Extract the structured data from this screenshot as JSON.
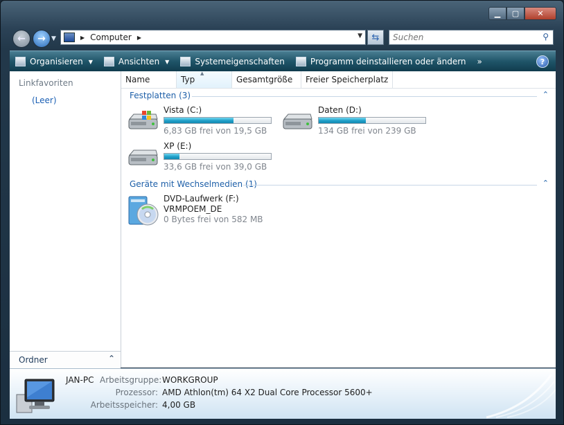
{
  "window": {
    "buttons": {
      "minimize": "▁",
      "maximize": "▢",
      "close": "✕"
    }
  },
  "address": {
    "location": "Computer",
    "separator_icon": "chevron-right"
  },
  "search": {
    "placeholder": "Suchen"
  },
  "toolbar": {
    "items": [
      {
        "label": "Organisieren",
        "icon": "organize-icon",
        "has_dropdown": true
      },
      {
        "label": "Ansichten",
        "icon": "views-icon",
        "has_dropdown": true
      },
      {
        "label": "Systemeigenschaften",
        "icon": "system-properties-icon",
        "has_dropdown": false
      },
      {
        "label": "Programm deinstallieren oder ändern",
        "icon": "uninstall-icon",
        "has_dropdown": false
      }
    ],
    "overflow": "»"
  },
  "left_pane": {
    "title": "Linkfavoriten",
    "items": [
      "(Leer)"
    ],
    "folders_label": "Ordner"
  },
  "columns": [
    "Name",
    "Typ",
    "Gesamtgröße",
    "Freier Speicherplatz"
  ],
  "groups": {
    "hard_disks": {
      "title": "Festplatten (3)",
      "drives": [
        {
          "name": "Vista (C:)",
          "free_text": "6,83 GB frei von 19,5 GB",
          "used_fraction": 0.65,
          "os_logo": true
        },
        {
          "name": "Daten (D:)",
          "free_text": "134 GB frei von 239 GB",
          "used_fraction": 0.44,
          "os_logo": false
        },
        {
          "name": "XP (E:)",
          "free_text": "33,6 GB frei von 39,0 GB",
          "used_fraction": 0.14,
          "os_logo": false
        }
      ]
    },
    "removable": {
      "title": "Geräte mit Wechselmedien (1)",
      "drives": [
        {
          "name": "DVD-Laufwerk (F:)",
          "label": "VRMPOEM_DE",
          "free_text": "0 Bytes frei von 582 MB"
        }
      ]
    }
  },
  "details": {
    "computer_name": "JAN-PC",
    "rows": [
      {
        "label": "Arbeitsgruppe:",
        "value": "WORKGROUP"
      },
      {
        "label": "Prozessor:",
        "value": "AMD Athlon(tm) 64 X2 Dual Core Processor 5600+"
      },
      {
        "label": "Arbeitsspeicher:",
        "value": "4,00 GB"
      }
    ]
  },
  "colors": {
    "accent": "#1d5fa8",
    "toolbar": "#1f5468",
    "bar_fill": "#1f9fc8"
  }
}
